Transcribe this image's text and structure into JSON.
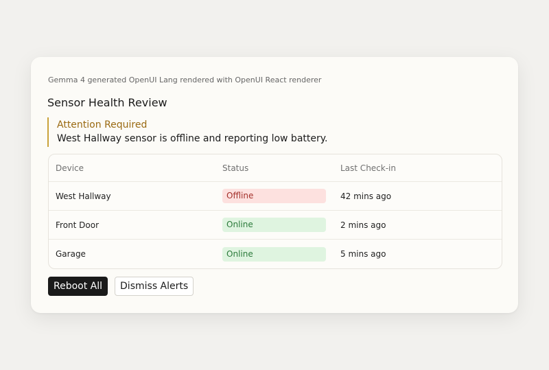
{
  "caption": "Gemma 4 generated OpenUI Lang rendered with OpenUI React renderer",
  "title": "Sensor Health Review",
  "alert": {
    "title": "Attention Required",
    "message": "West Hallway sensor is offline and reporting low battery."
  },
  "table": {
    "headers": [
      "Device",
      "Status",
      "Last Check-in"
    ],
    "rows": [
      {
        "device": "West Hallway",
        "status": "Offline",
        "checkin": "42 mins ago"
      },
      {
        "device": "Front Door",
        "status": "Online",
        "checkin": "2 mins ago"
      },
      {
        "device": "Garage",
        "status": "Online",
        "checkin": "5 mins ago"
      }
    ]
  },
  "actions": {
    "reboot_label": "Reboot All",
    "dismiss_label": "Dismiss Alerts"
  },
  "colors": {
    "accent": "#c9a23a",
    "offline": "#a3302a",
    "online": "#2b7a3a"
  }
}
